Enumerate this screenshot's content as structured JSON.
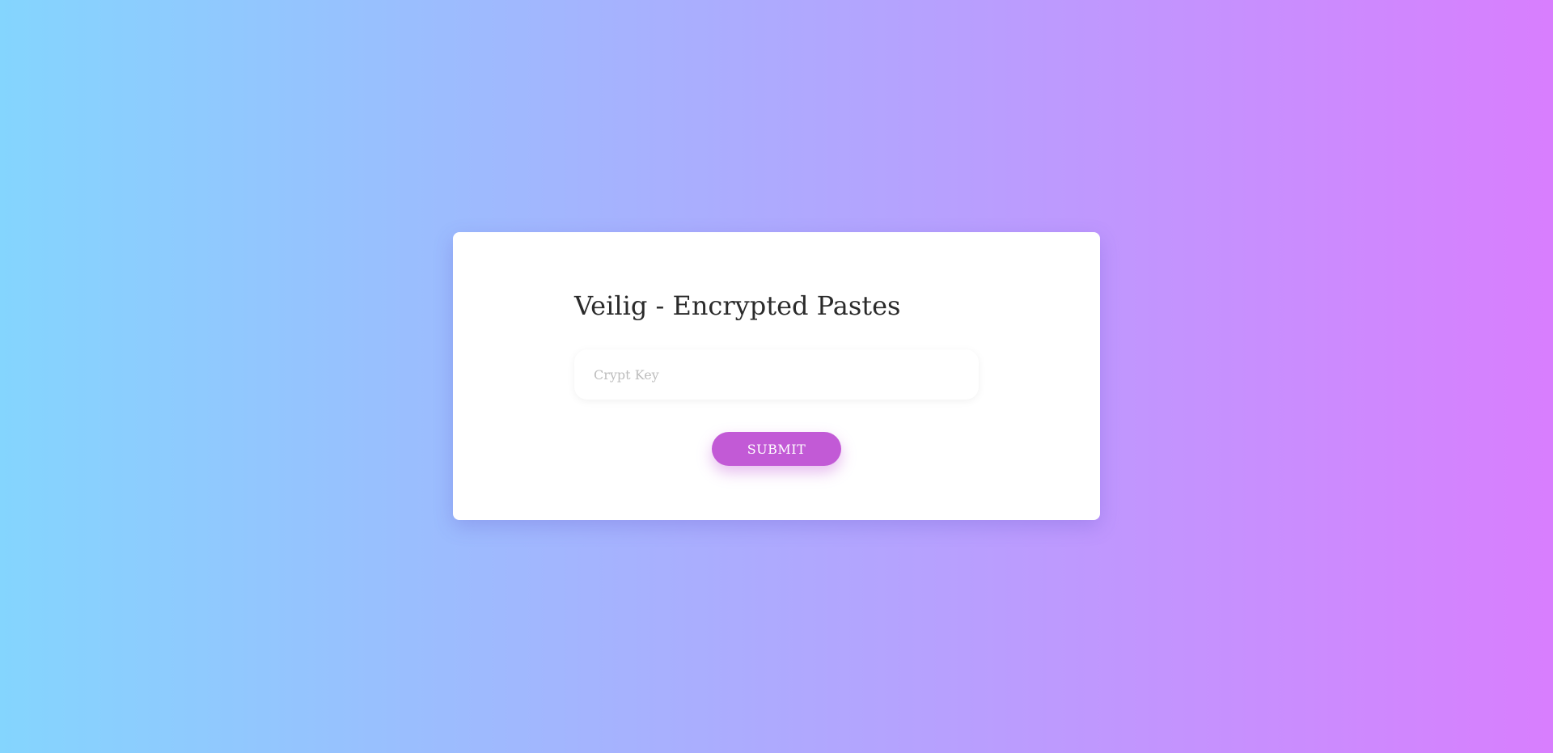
{
  "page": {
    "title": "Veilig - Encrypted Pastes"
  },
  "form": {
    "key_value": "",
    "key_placeholder": "Crypt Key",
    "submit_label": "SUBMIT"
  },
  "colors": {
    "gradient_start": "#84d5fe",
    "gradient_end": "#d87efe",
    "button": "#c25ad6",
    "card": "#ffffff"
  }
}
